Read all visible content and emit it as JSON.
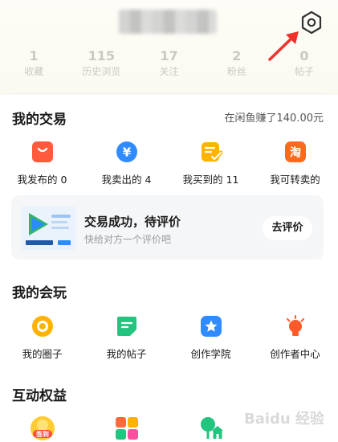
{
  "profile": {
    "username_blurred": true
  },
  "stats": [
    {
      "value": "1",
      "label": "收藏"
    },
    {
      "value": "115",
      "label": "历史浏览"
    },
    {
      "value": "17",
      "label": "关注"
    },
    {
      "value": "2",
      "label": "粉丝"
    },
    {
      "value": "0",
      "label": "帖子"
    }
  ],
  "trading": {
    "title": "我的交易",
    "earned": "在闲鱼赚了140.00元",
    "items": [
      {
        "label": "我发布的 0",
        "icon": "bag-icon",
        "color": "#ff5a3c"
      },
      {
        "label": "我卖出的 4",
        "icon": "yen-icon",
        "color": "#2f8bff"
      },
      {
        "label": "我买到的 11",
        "icon": "receipt-check-icon",
        "color": "#ffb300"
      },
      {
        "label": "我可转卖的",
        "icon": "taobao-icon",
        "color": "#ff6a1a"
      }
    ]
  },
  "review_card": {
    "title": "交易成功，待评价",
    "subtitle": "快给对方一个评价吧",
    "button": "去评价"
  },
  "play": {
    "title": "我的会玩",
    "items": [
      {
        "label": "我的圈子",
        "icon": "circle-ring-icon",
        "color": "#ffb300"
      },
      {
        "label": "我的帖子",
        "icon": "post-icon",
        "color": "#23c47e"
      },
      {
        "label": "创作学院",
        "icon": "star-badge-icon",
        "color": "#2f8bff"
      },
      {
        "label": "创作者中心",
        "icon": "bulb-icon",
        "color": "#ff5a2a"
      }
    ]
  },
  "interactive": {
    "title": "互动权益",
    "checkin_badge": "签到"
  },
  "watermark_text": "Baidu 经验"
}
